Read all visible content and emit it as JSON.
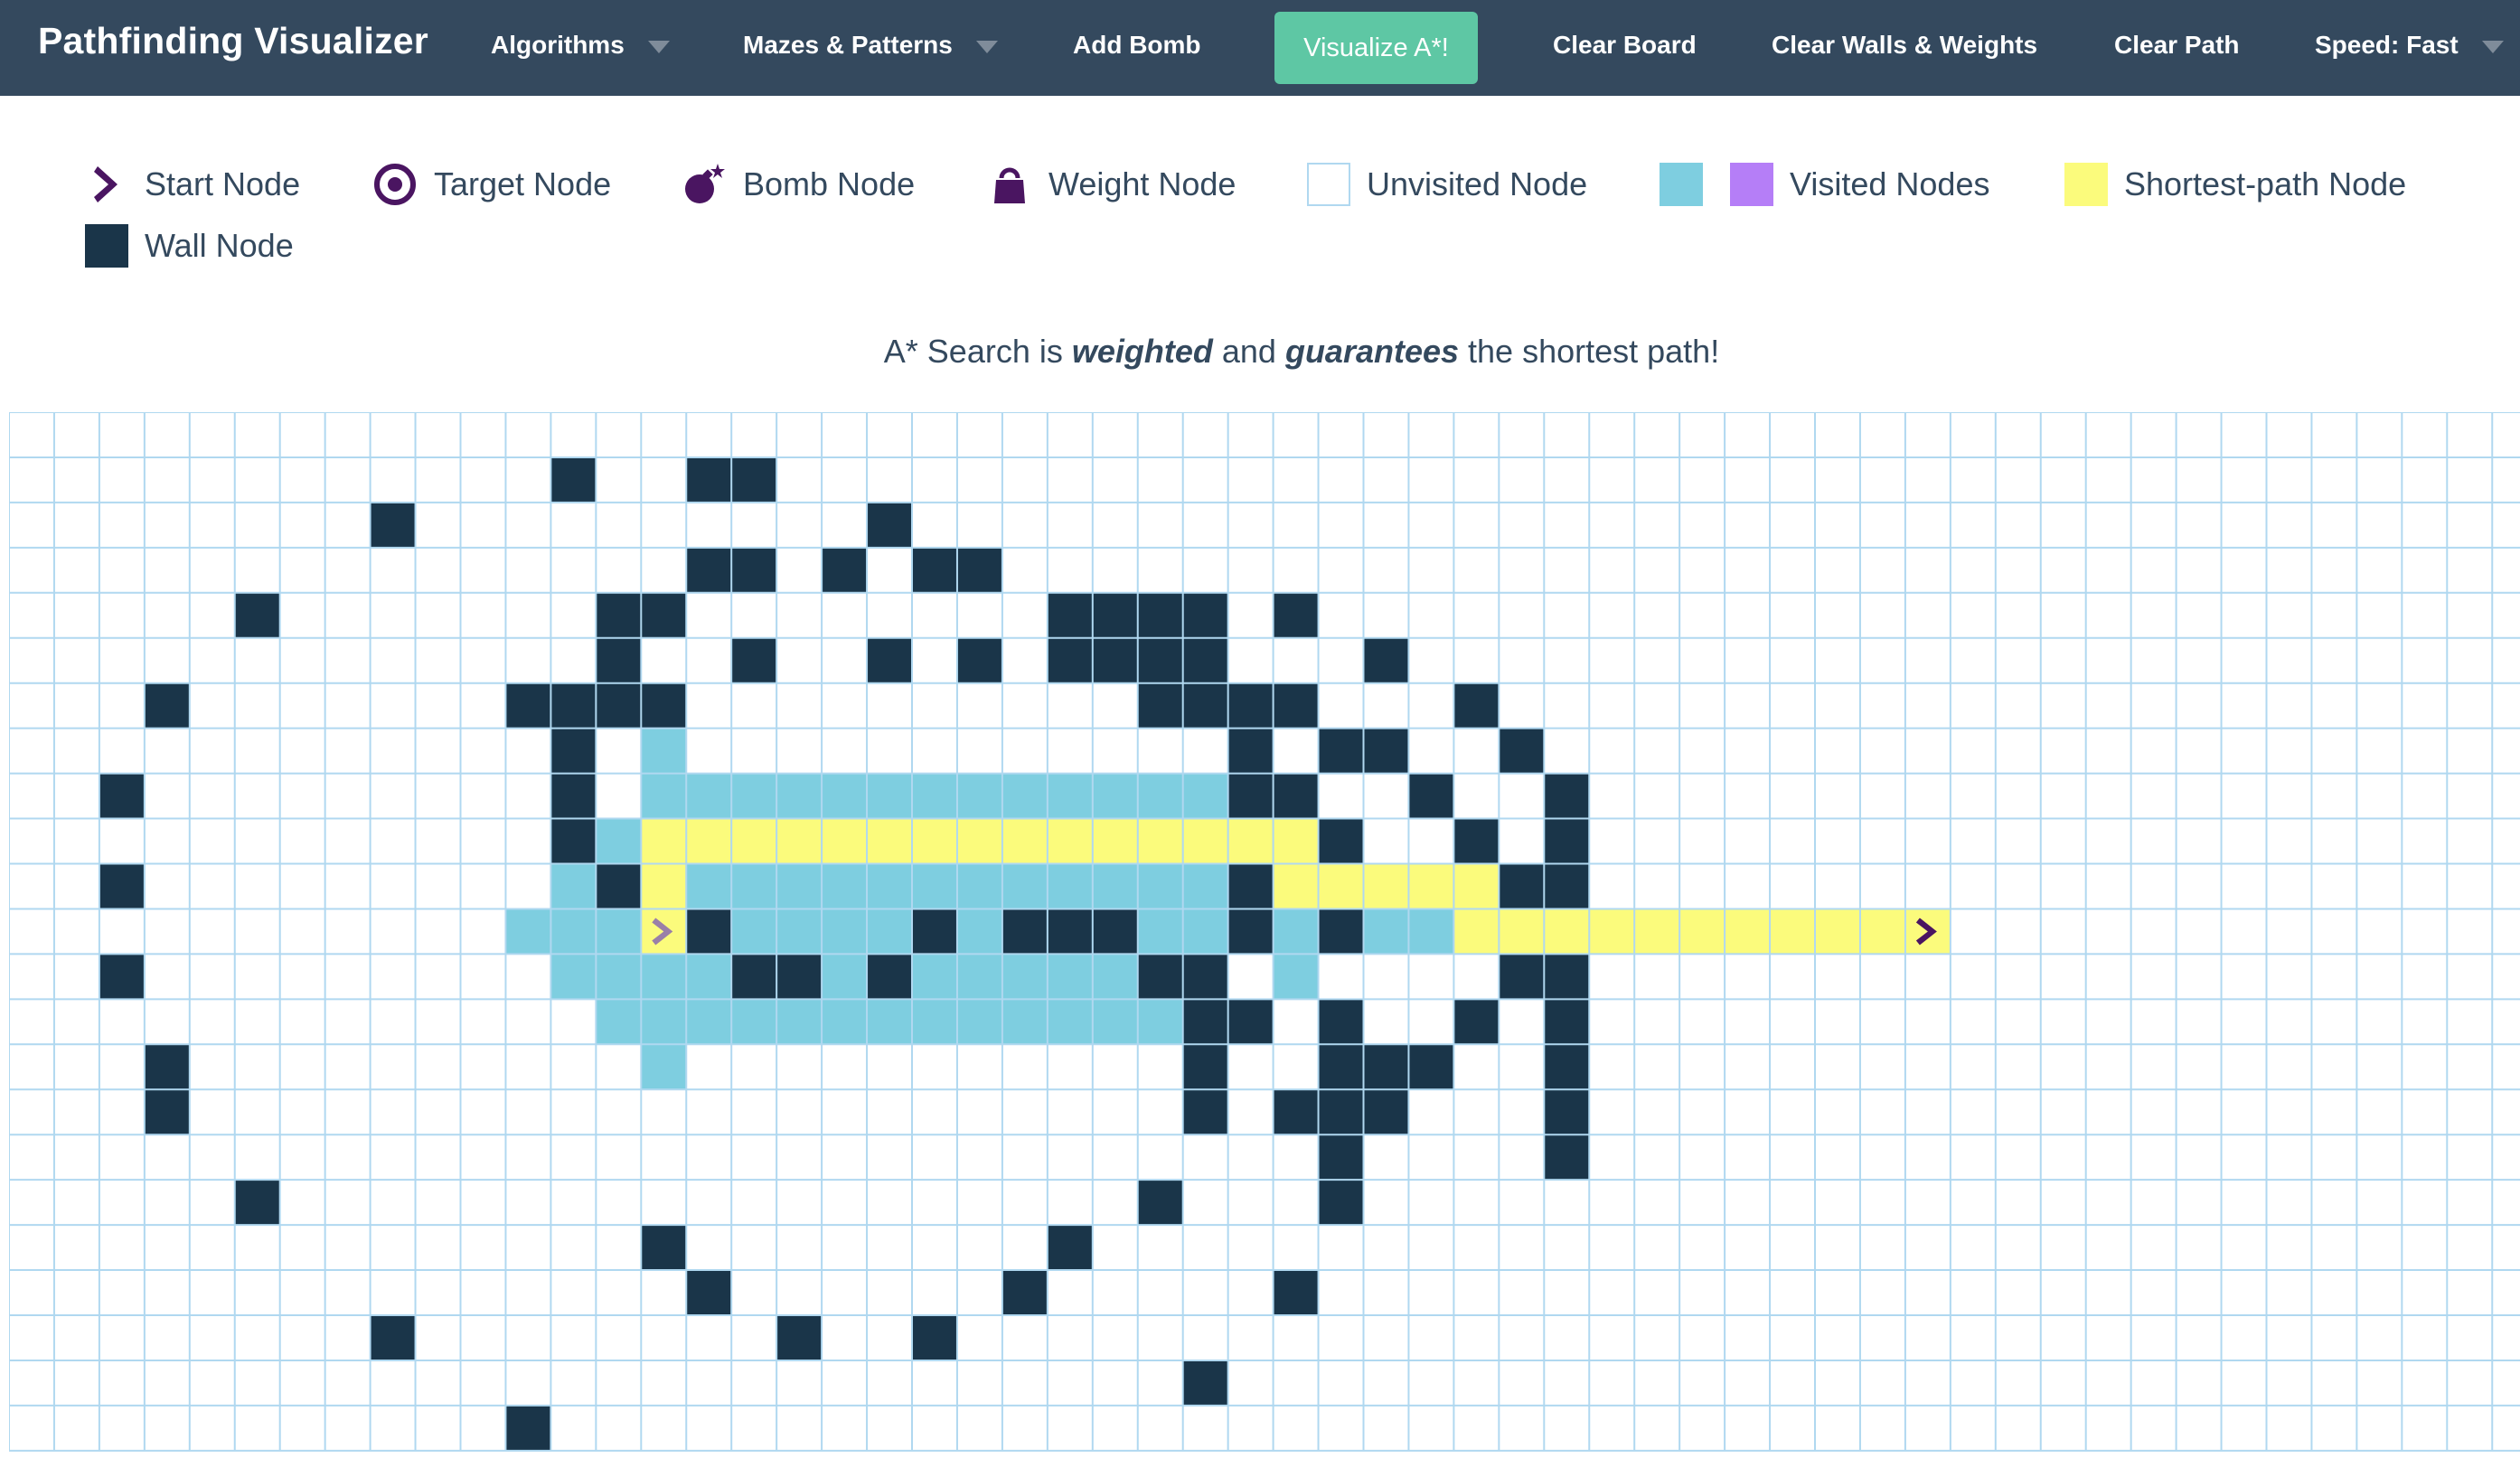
{
  "navbar": {
    "brand": "Pathfinding Visualizer",
    "algorithms": "Algorithms",
    "mazes": "Mazes & Patterns",
    "add_bomb": "Add Bomb",
    "visualize": "Visualize A*!",
    "clear_board": "Clear Board",
    "clear_walls_weights": "Clear Walls & Weights",
    "clear_path": "Clear Path",
    "speed": "Speed: Fast"
  },
  "legend": {
    "start": "Start Node",
    "target": "Target Node",
    "bomb": "Bomb Node",
    "weight": "Weight Node",
    "unvisited": "Unvisited Node",
    "visited": "Visited Nodes",
    "shortest": "Shortest-path Node",
    "wall": "Wall Node"
  },
  "description": {
    "prefix": "A* Search is ",
    "weighted": "weighted",
    "middle": " and ",
    "guarantees": "guarantees",
    "suffix": " the shortest path!"
  },
  "colors": {
    "navbar": "#34495e",
    "accent": "#5ec7a4",
    "wall": "#1a3549",
    "visited": "#7ecee0",
    "visited_alt": "#b57ef7",
    "path": "#fbfb7c",
    "grid_line": "#b0d8f0",
    "icon": "#4a1561"
  },
  "board": {
    "start": [
      11,
      14
    ],
    "target": [
      11,
      42
    ],
    "walls": [
      [
        1,
        12
      ],
      [
        1,
        15
      ],
      [
        1,
        16
      ],
      [
        2,
        8
      ],
      [
        2,
        19
      ],
      [
        3,
        15
      ],
      [
        3,
        16
      ],
      [
        3,
        18
      ],
      [
        3,
        20
      ],
      [
        3,
        21
      ],
      [
        4,
        5
      ],
      [
        4,
        13
      ],
      [
        4,
        14
      ],
      [
        4,
        23
      ],
      [
        4,
        24
      ],
      [
        4,
        25
      ],
      [
        4,
        26
      ],
      [
        4,
        28
      ],
      [
        5,
        13
      ],
      [
        5,
        16
      ],
      [
        5,
        19
      ],
      [
        5,
        21
      ],
      [
        5,
        23
      ],
      [
        5,
        24
      ],
      [
        5,
        25
      ],
      [
        5,
        26
      ],
      [
        5,
        30
      ],
      [
        6,
        3
      ],
      [
        6,
        11
      ],
      [
        6,
        12
      ],
      [
        6,
        13
      ],
      [
        6,
        14
      ],
      [
        6,
        25
      ],
      [
        6,
        26
      ],
      [
        6,
        27
      ],
      [
        6,
        28
      ],
      [
        6,
        32
      ],
      [
        7,
        12
      ],
      [
        7,
        27
      ],
      [
        7,
        29
      ],
      [
        7,
        30
      ],
      [
        7,
        33
      ],
      [
        8,
        2
      ],
      [
        8,
        12
      ],
      [
        8,
        27
      ],
      [
        8,
        28
      ],
      [
        8,
        31
      ],
      [
        8,
        34
      ],
      [
        9,
        12
      ],
      [
        9,
        29
      ],
      [
        9,
        32
      ],
      [
        9,
        34
      ],
      [
        10,
        2
      ],
      [
        10,
        13
      ],
      [
        10,
        27
      ],
      [
        10,
        33
      ],
      [
        10,
        34
      ],
      [
        11,
        15
      ],
      [
        11,
        20
      ],
      [
        11,
        22
      ],
      [
        11,
        23
      ],
      [
        11,
        24
      ],
      [
        11,
        27
      ],
      [
        11,
        29
      ],
      [
        12,
        2
      ],
      [
        12,
        16
      ],
      [
        12,
        17
      ],
      [
        12,
        19
      ],
      [
        12,
        25
      ],
      [
        12,
        26
      ],
      [
        12,
        33
      ],
      [
        12,
        34
      ],
      [
        13,
        26
      ],
      [
        13,
        27
      ],
      [
        13,
        29
      ],
      [
        13,
        32
      ],
      [
        13,
        34
      ],
      [
        14,
        3
      ],
      [
        14,
        26
      ],
      [
        14,
        29
      ],
      [
        14,
        30
      ],
      [
        14,
        31
      ],
      [
        14,
        34
      ],
      [
        15,
        3
      ],
      [
        15,
        26
      ],
      [
        15,
        28
      ],
      [
        15,
        29
      ],
      [
        15,
        30
      ],
      [
        15,
        34
      ],
      [
        16,
        29
      ],
      [
        16,
        34
      ],
      [
        17,
        5
      ],
      [
        17,
        25
      ],
      [
        17,
        29
      ],
      [
        18,
        14
      ],
      [
        18,
        23
      ],
      [
        19,
        15
      ],
      [
        19,
        22
      ],
      [
        19,
        28
      ],
      [
        20,
        8
      ],
      [
        20,
        17
      ],
      [
        20,
        20
      ],
      [
        21,
        26
      ],
      [
        22,
        11
      ]
    ],
    "visited": [
      [
        7,
        14
      ],
      [
        8,
        14
      ],
      [
        8,
        15
      ],
      [
        8,
        16
      ],
      [
        8,
        17
      ],
      [
        8,
        18
      ],
      [
        8,
        19
      ],
      [
        8,
        20
      ],
      [
        8,
        21
      ],
      [
        8,
        22
      ],
      [
        8,
        23
      ],
      [
        8,
        24
      ],
      [
        8,
        25
      ],
      [
        8,
        26
      ],
      [
        9,
        13
      ],
      [
        10,
        12
      ],
      [
        10,
        15
      ],
      [
        10,
        16
      ],
      [
        10,
        17
      ],
      [
        10,
        18
      ],
      [
        10,
        19
      ],
      [
        10,
        20
      ],
      [
        10,
        21
      ],
      [
        10,
        22
      ],
      [
        10,
        23
      ],
      [
        10,
        24
      ],
      [
        10,
        25
      ],
      [
        10,
        26
      ],
      [
        11,
        11
      ],
      [
        11,
        12
      ],
      [
        11,
        13
      ],
      [
        11,
        16
      ],
      [
        11,
        17
      ],
      [
        11,
        18
      ],
      [
        11,
        19
      ],
      [
        11,
        21
      ],
      [
        11,
        25
      ],
      [
        11,
        26
      ],
      [
        11,
        28
      ],
      [
        11,
        30
      ],
      [
        11,
        31
      ],
      [
        12,
        12
      ],
      [
        12,
        13
      ],
      [
        12,
        14
      ],
      [
        12,
        15
      ],
      [
        12,
        18
      ],
      [
        12,
        20
      ],
      [
        12,
        21
      ],
      [
        12,
        22
      ],
      [
        12,
        23
      ],
      [
        12,
        24
      ],
      [
        12,
        28
      ],
      [
        13,
        13
      ],
      [
        13,
        14
      ],
      [
        13,
        15
      ],
      [
        13,
        16
      ],
      [
        13,
        17
      ],
      [
        13,
        18
      ],
      [
        13,
        19
      ],
      [
        13,
        20
      ],
      [
        13,
        21
      ],
      [
        13,
        22
      ],
      [
        13,
        23
      ],
      [
        13,
        24
      ],
      [
        13,
        25
      ],
      [
        14,
        14
      ]
    ],
    "path": [
      [
        9,
        14
      ],
      [
        9,
        15
      ],
      [
        9,
        16
      ],
      [
        9,
        17
      ],
      [
        9,
        18
      ],
      [
        9,
        19
      ],
      [
        9,
        20
      ],
      [
        9,
        21
      ],
      [
        9,
        22
      ],
      [
        9,
        23
      ],
      [
        9,
        24
      ],
      [
        9,
        25
      ],
      [
        9,
        26
      ],
      [
        9,
        27
      ],
      [
        9,
        28
      ],
      [
        10,
        14
      ],
      [
        10,
        28
      ],
      [
        10,
        29
      ],
      [
        10,
        30
      ],
      [
        10,
        31
      ],
      [
        10,
        32
      ],
      [
        11,
        32
      ],
      [
        11,
        33
      ],
      [
        11,
        34
      ],
      [
        11,
        35
      ],
      [
        11,
        36
      ],
      [
        11,
        37
      ],
      [
        11,
        38
      ],
      [
        11,
        39
      ],
      [
        11,
        40
      ],
      [
        11,
        41
      ]
    ]
  }
}
